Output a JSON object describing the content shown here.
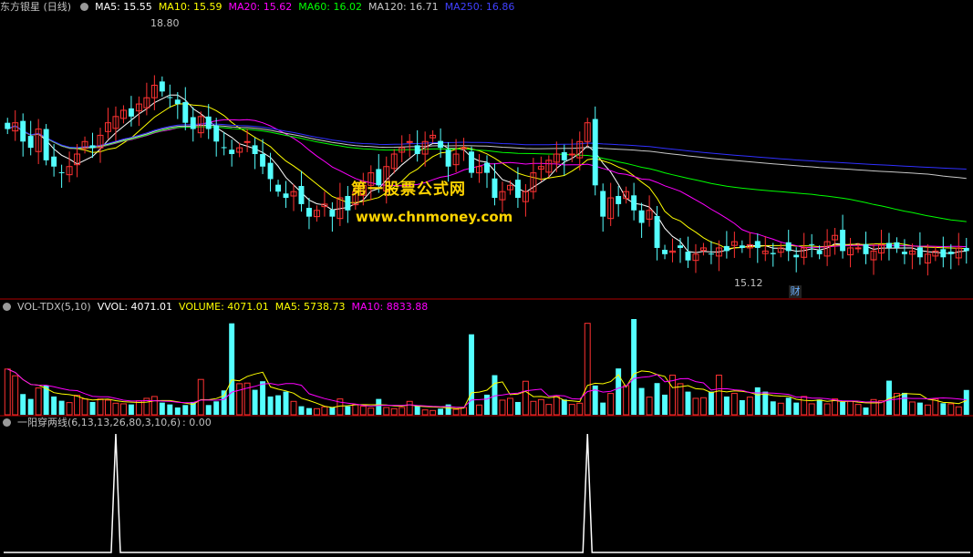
{
  "header_main": {
    "title": "东方银星 (日线)",
    "ma5": "MA5: 15.55",
    "ma10": "MA10: 15.59",
    "ma20": "MA20: 15.62",
    "ma60": "MA60: 16.02",
    "ma120": "MA120: 16.71",
    "ma250": "MA250: 16.86"
  },
  "header_vol": {
    "title": "VOL-TDX(5,10)",
    "vvol": "VVOL: 4071.01",
    "volume": "VOLUME: 4071.01",
    "ma5": "MA5: 5738.73",
    "ma10": "MA10: 8833.88"
  },
  "header_ind": {
    "title": "一阳穿两线(6,13,13,26,80,3,10,6)",
    "value": ": 0.00"
  },
  "annotations": {
    "high": "18.80",
    "low": "15.12",
    "cai": "财"
  },
  "watermark": {
    "line1": "第一股票公式网",
    "line2": "www.chnmoney.com"
  },
  "colors": {
    "up": "#ff3232",
    "down": "#54ffff",
    "ma5": "#ffffff",
    "ma10": "#ffff00",
    "ma20": "#ff00ff",
    "ma60": "#00ff00",
    "ma120": "#c8c8c8",
    "ma250": "#3030ff",
    "separator": "#b00000"
  },
  "chart_data": [
    {
      "type": "candlestick",
      "title": "东方银星 (日线)",
      "price_range": [
        14.9,
        19.3
      ],
      "annotations": [
        {
          "label": "18.80",
          "value": 18.8
        },
        {
          "label": "15.12",
          "value": 15.12
        }
      ],
      "ma_lines": [
        {
          "name": "MA5",
          "value": 15.55,
          "color": "#ffffff"
        },
        {
          "name": "MA10",
          "value": 15.59,
          "color": "#ffff00"
        },
        {
          "name": "MA20",
          "value": 15.62,
          "color": "#ff00ff"
        },
        {
          "name": "MA60",
          "value": 16.02,
          "color": "#00ff00"
        },
        {
          "name": "MA120",
          "value": 16.71,
          "color": "#c8c8c8"
        },
        {
          "name": "MA250",
          "value": 16.86,
          "color": "#3030ff"
        }
      ],
      "closes": [
        17.5,
        17.6,
        17.3,
        17.2,
        17.5,
        17.0,
        16.9,
        16.8,
        16.9,
        17.1,
        17.3,
        17.2,
        17.4,
        17.6,
        17.7,
        17.8,
        17.7,
        17.9,
        18.0,
        18.2,
        18.1,
        18.0,
        17.9,
        17.6,
        17.5,
        17.7,
        17.5,
        17.3,
        17.2,
        17.1,
        17.2,
        17.3,
        17.1,
        16.9,
        16.7,
        16.5,
        16.4,
        16.5,
        16.3,
        16.1,
        16.2,
        16.3,
        16.1,
        16.4,
        16.2,
        16.5,
        16.6,
        16.8,
        16.6,
        16.9,
        17.1,
        17.2,
        17.3,
        17.1,
        17.3,
        17.4,
        17.2,
        16.9,
        17.1,
        17.2,
        16.8,
        16.9,
        16.8,
        16.4,
        16.5,
        16.6,
        16.4,
        16.5,
        16.8,
        16.9,
        17.0,
        17.1,
        17.0,
        17.1,
        17.3,
        17.6,
        16.6,
        16.1,
        16.4,
        16.3,
        16.5,
        16.2,
        16.0,
        16.2,
        15.6,
        15.5,
        15.55,
        15.6,
        15.4,
        15.5,
        15.6,
        15.5,
        15.6,
        15.55,
        15.7,
        15.6,
        15.65,
        15.6,
        15.55,
        15.5,
        15.6,
        15.55,
        15.45,
        15.6,
        15.65,
        15.5,
        15.7,
        15.8,
        15.55,
        15.6,
        15.6,
        15.5,
        15.55,
        15.65,
        15.6,
        15.6,
        15.5,
        15.55,
        15.45,
        15.5,
        15.55,
        15.45,
        15.5,
        15.6,
        15.55
      ],
      "highs_note": "estimated"
    },
    {
      "type": "bar",
      "title": "VOL-TDX(5,10)",
      "ylim": [
        0,
        16000
      ],
      "series": [
        {
          "name": "VOLUME",
          "last": 4071.01
        },
        {
          "name": "MA5",
          "last": 5738.73
        },
        {
          "name": "MA10",
          "last": 8833.88
        }
      ],
      "volumes": [
        7500,
        6400,
        3400,
        2600,
        4400,
        4800,
        3000,
        2300,
        2000,
        3200,
        2600,
        2100,
        2600,
        2400,
        1900,
        1800,
        1700,
        2300,
        2700,
        3000,
        2000,
        1700,
        1200,
        1600,
        2100,
        5800,
        1600,
        2200,
        4000,
        15000,
        5100,
        5200,
        4100,
        5500,
        3000,
        3200,
        3800,
        2200,
        1400,
        1100,
        1000,
        1300,
        1200,
        2600,
        1400,
        1700,
        1400,
        1100,
        2600,
        1200,
        1000,
        1200,
        2200,
        1500,
        800,
        700,
        1000,
        1700,
        900,
        1200,
        13200,
        1600,
        3300,
        6500,
        2400,
        2700,
        2100,
        5500,
        2200,
        2500,
        1700,
        3000,
        2500,
        1700,
        1900,
        15000,
        4800,
        2000,
        3500,
        7600,
        4800,
        15700,
        4400,
        2900,
        5200,
        3300,
        6500,
        5100,
        3800,
        2700,
        2800,
        3800,
        6500,
        3000,
        3500,
        2400,
        2900,
        4500,
        3800,
        2200,
        1900,
        2800,
        2000,
        3000,
        1800,
        2500,
        1800,
        2600,
        2100,
        2200,
        1700,
        1200,
        2500,
        2300,
        5600,
        3500,
        3600,
        2100,
        2000,
        1600,
        2600,
        1900,
        1800,
        1300,
        4071
      ]
    },
    {
      "type": "line",
      "title": "一阳穿两线(6,13,13,26,80,3,10,6)",
      "last_value": 0.0,
      "signals": [
        {
          "index": 14,
          "value": 1
        },
        {
          "index": 75,
          "value": 1
        }
      ]
    }
  ]
}
